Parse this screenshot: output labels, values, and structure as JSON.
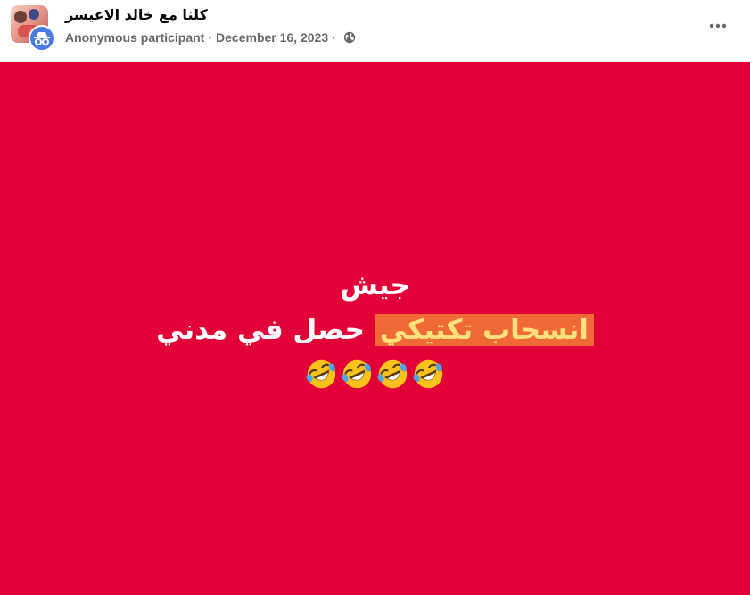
{
  "post": {
    "group_name": "كلنا مع خالد الاعيسر",
    "author": "Anonymous participant",
    "separator": "·",
    "date": "December 16, 2023",
    "privacy_icon": "globe-icon",
    "more_icon": "more-options-icon",
    "avatar_icon": "incognito-icon"
  },
  "image": {
    "background_color": "#e10037",
    "line1": "جيش",
    "line2_highlight": "انسحاب تكتيكي",
    "line2_rest": "حصل في مدني",
    "emoji_count": 4,
    "emoji_name": "rolling-on-the-floor-laughing",
    "highlight_bg": "#ef6a37",
    "highlight_text_color": "#ffe07a"
  }
}
